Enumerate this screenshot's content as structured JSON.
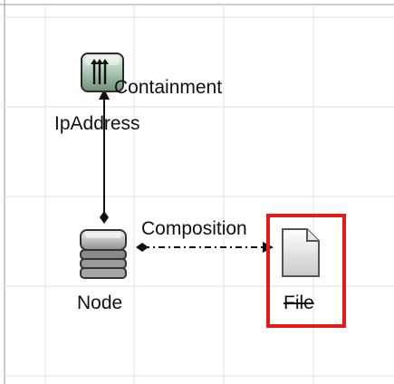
{
  "diagram": {
    "nodes": {
      "ipaddress": {
        "label": "IpAddress",
        "icon": "ip-address-icon"
      },
      "node": {
        "label": "Node",
        "icon": "server-stack-icon"
      },
      "file": {
        "label": "File",
        "icon": "file-document-icon",
        "strikethrough": true,
        "selected": true
      }
    },
    "edges": {
      "containment": {
        "label": "Containment",
        "from": "Node",
        "to": "IpAddress",
        "style": "solid"
      },
      "composition": {
        "label": "Composition",
        "from": "Node",
        "to": "File",
        "style": "dash-dot"
      }
    },
    "colors": {
      "grid": "#e2e2e2",
      "selection": "#e31b1b",
      "edge": "#111111"
    }
  }
}
